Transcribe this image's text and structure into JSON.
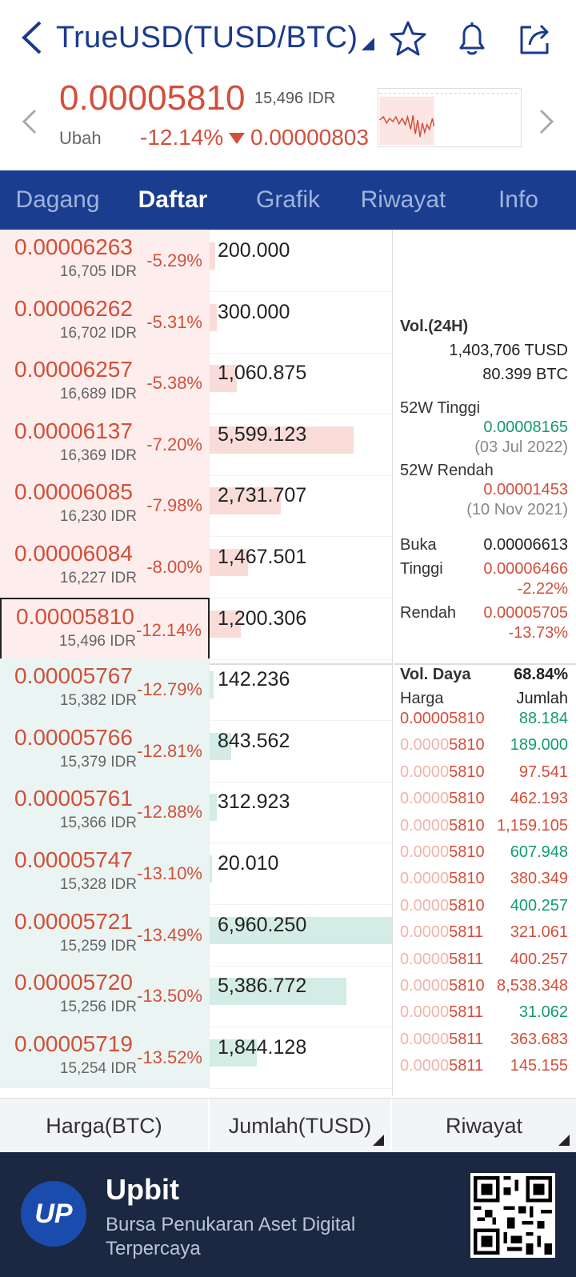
{
  "header": {
    "title": "TrueUSD(TUSD/BTC)",
    "icons": [
      "back-icon",
      "star-icon",
      "bell-icon",
      "share-icon"
    ]
  },
  "price": {
    "current": "0.00005810",
    "idr": "15,496 IDR",
    "change_label": "Ubah",
    "change_pct": "-12.14%",
    "change_abs": "0.00000803"
  },
  "tabs": [
    {
      "label": "Dagang",
      "active": false
    },
    {
      "label": "Daftar",
      "active": true
    },
    {
      "label": "Grafik",
      "active": false
    },
    {
      "label": "Riwayat",
      "active": false
    },
    {
      "label": "Info",
      "active": false
    }
  ],
  "orderbook": {
    "asks": [
      {
        "price": "0.00006263",
        "idr": "16,705 IDR",
        "pct": "-5.29%",
        "qty": "200.000",
        "fill": 0.03
      },
      {
        "price": "0.00006262",
        "idr": "16,702 IDR",
        "pct": "-5.31%",
        "qty": "300.000",
        "fill": 0.04
      },
      {
        "price": "0.00006257",
        "idr": "16,689 IDR",
        "pct": "-5.38%",
        "qty": "1,060.875",
        "fill": 0.15
      },
      {
        "price": "0.00006137",
        "idr": "16,369 IDR",
        "pct": "-7.20%",
        "qty": "5,599.123",
        "fill": 0.79
      },
      {
        "price": "0.00006085",
        "idr": "16,230 IDR",
        "pct": "-7.98%",
        "qty": "2,731.707",
        "fill": 0.39
      },
      {
        "price": "0.00006084",
        "idr": "16,227 IDR",
        "pct": "-8.00%",
        "qty": "1,467.501",
        "fill": 0.21
      },
      {
        "price": "0.00005810",
        "idr": "15,496 IDR",
        "pct": "-12.14%",
        "qty": "1,200.306",
        "fill": 0.17,
        "current": true
      }
    ],
    "bids": [
      {
        "price": "0.00005767",
        "idr": "15,382 IDR",
        "pct": "-12.79%",
        "qty": "142.236",
        "fill": 0.02
      },
      {
        "price": "0.00005766",
        "idr": "15,379 IDR",
        "pct": "-12.81%",
        "qty": "843.562",
        "fill": 0.12
      },
      {
        "price": "0.00005761",
        "idr": "15,366 IDR",
        "pct": "-12.88%",
        "qty": "312.923",
        "fill": 0.04
      },
      {
        "price": "0.00005747",
        "idr": "15,328 IDR",
        "pct": "-13.10%",
        "qty": "20.010",
        "fill": 0.0
      },
      {
        "price": "0.00005721",
        "idr": "15,259 IDR",
        "pct": "-13.49%",
        "qty": "6,960.250",
        "fill": 1.0
      },
      {
        "price": "0.00005720",
        "idr": "15,256 IDR",
        "pct": "-13.50%",
        "qty": "5,386.772",
        "fill": 0.75
      },
      {
        "price": "0.00005719",
        "idr": "15,254 IDR",
        "pct": "-13.52%",
        "qty": "1,844.128",
        "fill": 0.26
      }
    ]
  },
  "info": {
    "vol_label": "Vol.(24H)",
    "vol_tusd": "1,403,706 TUSD",
    "vol_btc": "80.399 BTC",
    "high52_label": "52W Tinggi",
    "high52": "0.00008165",
    "high52_date": "(03 Jul 2022)",
    "low52_label": "52W Rendah",
    "low52": "0.00001453",
    "low52_date": "(10 Nov 2021)",
    "open_label": "Buka",
    "open": "0.00006613",
    "high_label": "Tinggi",
    "high": "0.00006466",
    "high_pct": "-2.22%",
    "low_label": "Rendah",
    "low": "0.00005705",
    "low_pct": "-13.73%"
  },
  "trades": {
    "power_label": "Vol. Daya",
    "power": "68.84%",
    "price_col": "Harga",
    "qty_col": "Jumlah",
    "rows": [
      {
        "faded": "",
        "price": "0.00005810",
        "qty": "88.184",
        "side": "buy"
      },
      {
        "faded": "0.0000",
        "price": "5810",
        "qty": "189.000",
        "side": "buy"
      },
      {
        "faded": "0.0000",
        "price": "5810",
        "qty": "97.541",
        "side": "sell"
      },
      {
        "faded": "0.0000",
        "price": "5810",
        "qty": "462.193",
        "side": "sell"
      },
      {
        "faded": "0.0000",
        "price": "5810",
        "qty": "1,159.105",
        "side": "sell"
      },
      {
        "faded": "0.0000",
        "price": "5810",
        "qty": "607.948",
        "side": "buy"
      },
      {
        "faded": "0.0000",
        "price": "5810",
        "qty": "380.349",
        "side": "sell"
      },
      {
        "faded": "0.0000",
        "price": "5810",
        "qty": "400.257",
        "side": "buy"
      },
      {
        "faded": "0.0000",
        "price": "5811",
        "qty": "321.061",
        "side": "sell"
      },
      {
        "faded": "0.0000",
        "price": "5811",
        "qty": "400.257",
        "side": "sell"
      },
      {
        "faded": "0.0000",
        "price": "5810",
        "qty": "8,538.348",
        "side": "sell"
      },
      {
        "faded": "0.0000",
        "price": "5811",
        "qty": "31.062",
        "side": "buy"
      },
      {
        "faded": "0.0000",
        "price": "5811",
        "qty": "363.683",
        "side": "sell"
      },
      {
        "faded": "0.0000",
        "price": "5811",
        "qty": "145.155",
        "side": "sell"
      }
    ]
  },
  "columns": {
    "price": "Harga(BTC)",
    "qty": "Jumlah(TUSD)",
    "history": "Riwayat"
  },
  "banner": {
    "logo_text": "UP",
    "brand": "Upbit",
    "tagline": "Bursa Penukaran Aset Digital Terpercaya"
  },
  "colors": {
    "accent": "#1a3d8f",
    "down": "#d24f3a",
    "up": "#139a6c"
  }
}
